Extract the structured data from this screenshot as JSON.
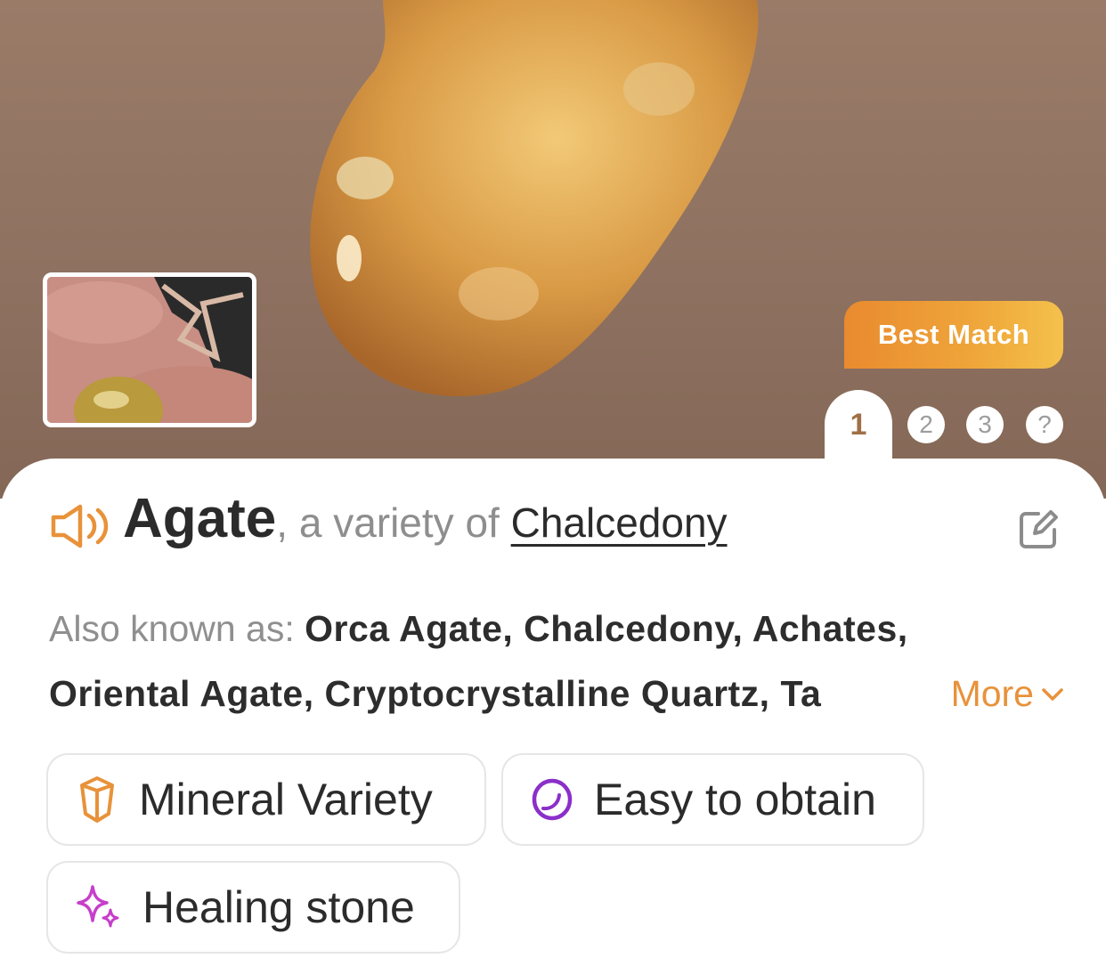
{
  "hero": {
    "badge": "Best Match",
    "pager": [
      "1",
      "2",
      "3",
      "?"
    ],
    "selected_result": "1"
  },
  "header": {
    "name": "Agate",
    "variety_prefix": ", a variety of ",
    "parent_link": "Chalcedony"
  },
  "aka": {
    "label": "Also known as: ",
    "line1_names": "Orca Agate, Chalcedony, Achates,",
    "line2_names": "Oriental Agate, Cryptocrystalline Quartz, Ta",
    "more": "More"
  },
  "chips": [
    {
      "label": "Mineral Variety",
      "icon": "crystal-icon",
      "color": "#e8923a"
    },
    {
      "label": "Easy to obtain",
      "icon": "stone-icon",
      "color": "#8b2fc9"
    },
    {
      "label": "Healing stone",
      "icon": "sparkle-icon",
      "color": "#c73ecb"
    }
  ],
  "colors": {
    "accent": "#e8923a",
    "badge_start": "#e98a2f",
    "badge_end": "#f4c14b"
  }
}
